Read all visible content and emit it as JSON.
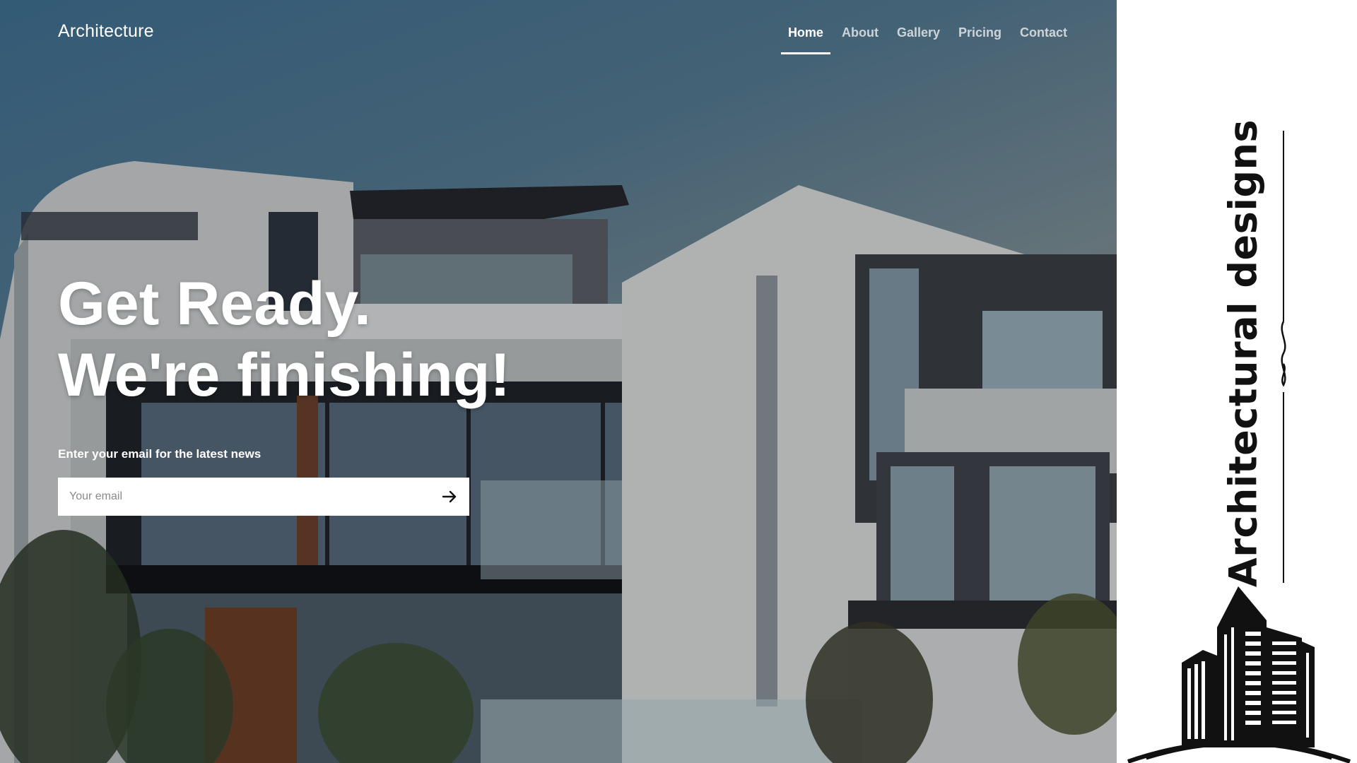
{
  "header": {
    "brand": "Architecture",
    "nav": [
      {
        "label": "Home",
        "active": true
      },
      {
        "label": "About",
        "active": false
      },
      {
        "label": "Gallery",
        "active": false
      },
      {
        "label": "Pricing",
        "active": false
      },
      {
        "label": "Contact",
        "active": false
      }
    ]
  },
  "hero": {
    "headline_line1": "Get Ready.",
    "headline_line2": "We're finishing!",
    "news_label": "Enter your email for the latest news",
    "email_placeholder": "Your email",
    "submit_icon": "arrow-right-icon"
  },
  "side_panel": {
    "title": "Architectural designs",
    "logo_icon": "building-logo-icon",
    "divider_icon": "ornamental-divider-icon"
  },
  "colors": {
    "text_light": "#ffffff",
    "side_text": "#111111",
    "side_bg": "#ffffff"
  }
}
